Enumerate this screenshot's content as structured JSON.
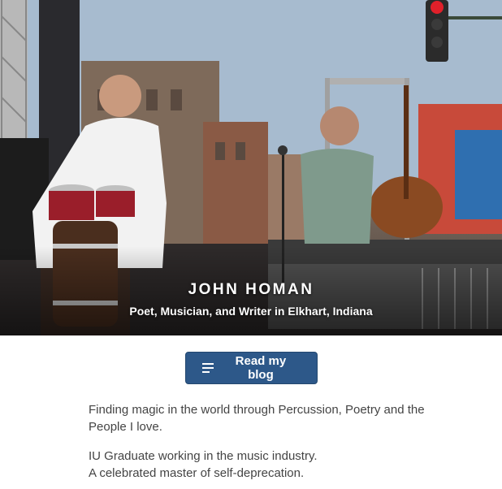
{
  "hero": {
    "title": "JOHN HOMAN",
    "subtitle": "Poet, Musician, and Writer in Elkhart, Indiana"
  },
  "cta": {
    "label": "Read my blog",
    "icon": "list-icon"
  },
  "bio": {
    "paragraph_1": "Finding magic in the world through Percussion, Poetry and the People I love.",
    "paragraph_2_line_1": "IU Graduate working in the music industry.",
    "paragraph_2_line_2": "A celebrated master of self-deprecation."
  }
}
